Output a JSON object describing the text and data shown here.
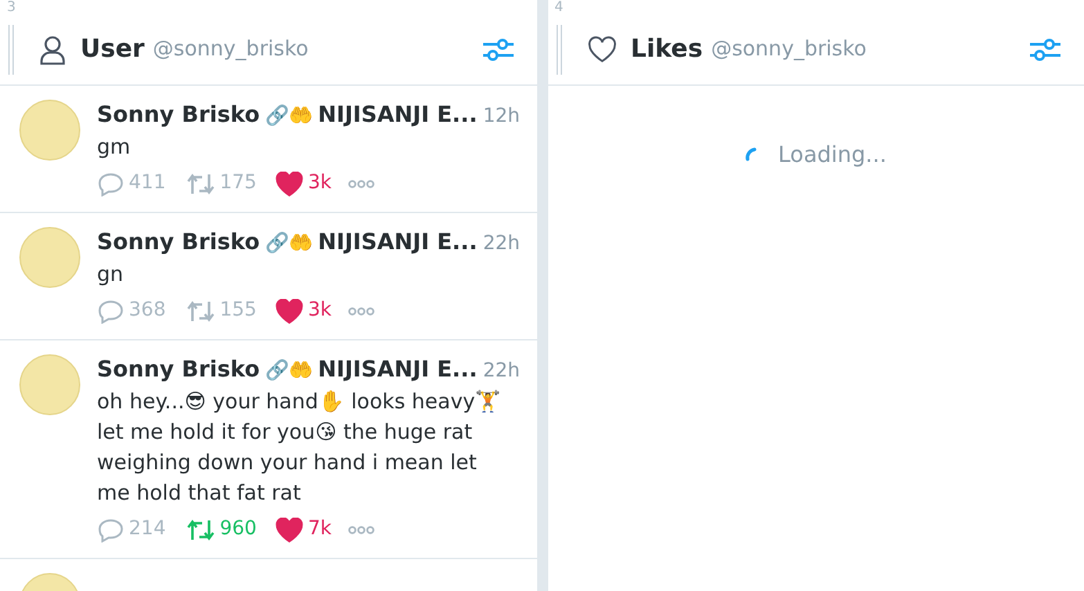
{
  "columns": [
    {
      "number": "3",
      "kind": "user",
      "title": "User",
      "handle": "@sonny_brisko",
      "tweets": [
        {
          "name": "Sonny Brisko",
          "emoji": "🔗🤲",
          "org": "NIJISANJI E...",
          "time": "12h",
          "text": "gm",
          "replies": "411",
          "retweets": "175",
          "likes": "3k",
          "retweeted": false,
          "liked": true
        },
        {
          "name": "Sonny Brisko",
          "emoji": "🔗🤲",
          "org": "NIJISANJI E...",
          "time": "22h",
          "text": "gn",
          "replies": "368",
          "retweets": "155",
          "likes": "3k",
          "retweeted": false,
          "liked": true
        },
        {
          "name": "Sonny Brisko",
          "emoji": "🔗🤲",
          "org": "NIJISANJI E...",
          "time": "22h",
          "text": "oh hey...😎 your hand✋ looks heavy🏋 let me hold it for you😘 the huge rat weighing down your hand i mean let me hold that fat rat",
          "replies": "214",
          "retweets": "960",
          "likes": "7k",
          "retweeted": true,
          "liked": true
        }
      ]
    },
    {
      "number": "4",
      "kind": "likes",
      "title": "Likes",
      "handle": "@sonny_brisko",
      "loading_text": "Loading..."
    }
  ]
}
